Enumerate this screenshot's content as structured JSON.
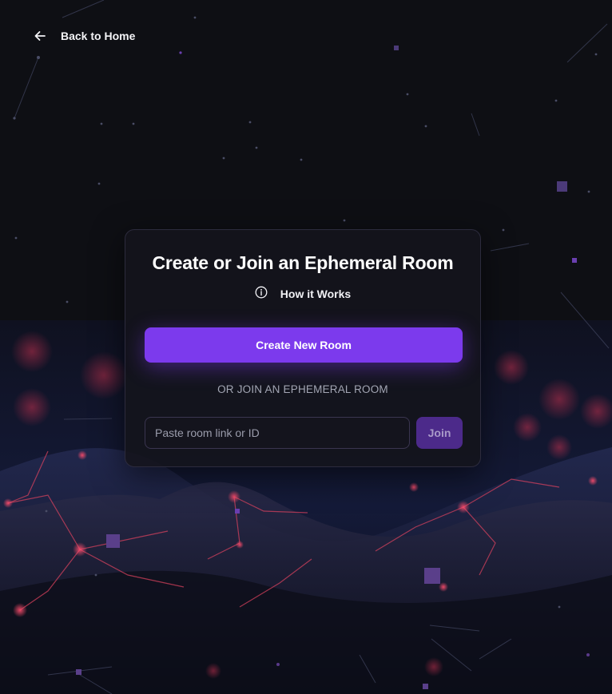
{
  "nav": {
    "back_label": "Back to Home"
  },
  "room_panel": {
    "title": "Create or Join an Ephemeral Room",
    "how_it_works_label": "How it Works",
    "create_button_label": "Create New Room",
    "divider_text": "OR JOIN AN EPHEMERAL ROOM",
    "room_input_value": "",
    "room_input_placeholder": "Paste room link or ID",
    "join_button_label": "Join"
  },
  "icons": {
    "back": "arrow-left-icon",
    "info": "info-circle-icon"
  },
  "colors": {
    "background": "#0e0f14",
    "accent": "#7c3aed",
    "join_button": "#4c2a8a",
    "card_border": "#2c2b3d"
  }
}
